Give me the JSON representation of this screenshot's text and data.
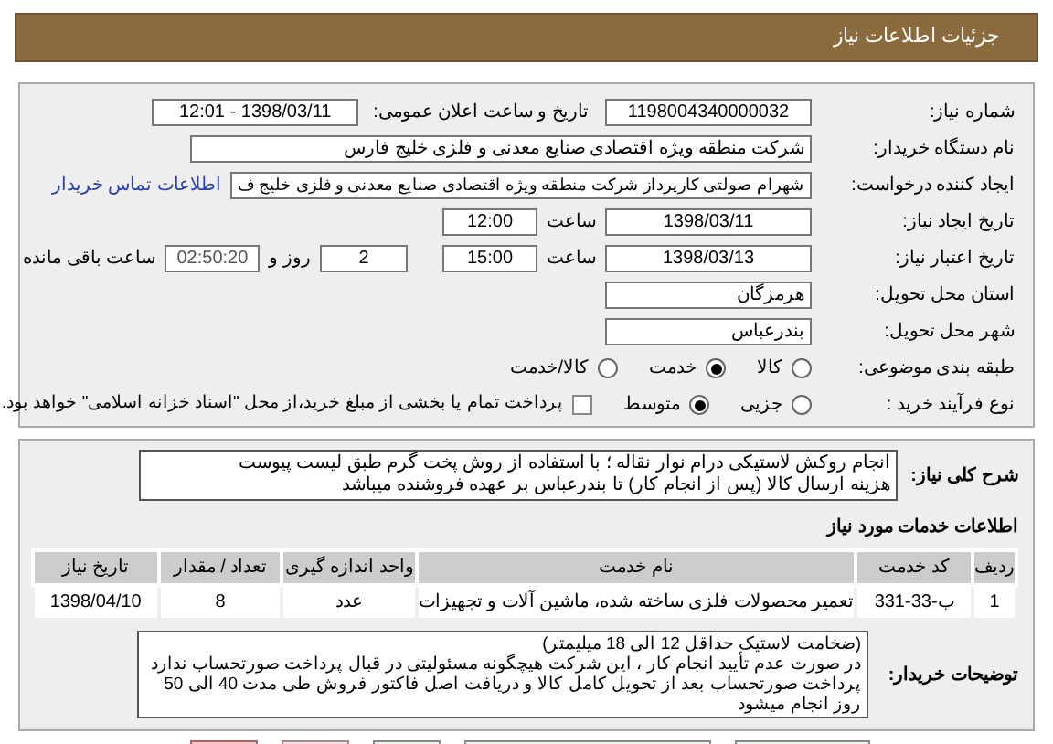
{
  "header": {
    "title": "جزئیات اطلاعات نیاز"
  },
  "form": {
    "need_number": {
      "label": "شماره نیاز:",
      "value": "1198004340000032"
    },
    "announce": {
      "label": "تاریخ و ساعت اعلان عمومی:",
      "value": "1398/03/11 - 12:01"
    },
    "buyer_org": {
      "label": "نام دستگاه خریدار:",
      "value": "شرکت منطقه ویژه اقتصادی صنایع معدنی و فلزی خلیج فارس"
    },
    "creator": {
      "label": "ایجاد کننده درخواست:",
      "value": "شهرام صولتی کارپرداز شرکت منطقه ویژه اقتصادی صنایع معدنی و فلزی خلیج ف",
      "link": "اطلاعات تماس خریدار"
    },
    "created": {
      "label": "تاریخ ایجاد نیاز:",
      "date": "1398/03/11",
      "time_label": "ساعت",
      "time": "12:00"
    },
    "valid": {
      "label": "تاریخ اعتبار نیاز:",
      "date": "1398/03/13",
      "time_label": "ساعت",
      "time": "15:00",
      "days": "2",
      "days_label": "روز و",
      "remaining": "02:50:20",
      "remaining_label": "ساعت باقی مانده"
    },
    "province": {
      "label": "استان محل تحویل:",
      "value": "هرمزگان"
    },
    "city": {
      "label": "شهر محل تحویل:",
      "value": "بندرعباس"
    },
    "category": {
      "label": "طبقه بندی موضوعی:",
      "options": [
        {
          "label": "کالا",
          "selected": false
        },
        {
          "label": "خدمت",
          "selected": true
        },
        {
          "label": "کالا/خدمت",
          "selected": false
        }
      ]
    },
    "process": {
      "label": "نوع فرآیند خرید :",
      "options": [
        {
          "label": "جزیی",
          "selected": false
        },
        {
          "label": "متوسط",
          "selected": true
        }
      ],
      "treasury": {
        "label": "پرداخت تمام یا بخشی از مبلغ خرید،از محل \"اسناد خزانه اسلامی\" خواهد بود.",
        "checked": false
      }
    }
  },
  "description": {
    "label": "شرح کلی نیاز:",
    "lines": [
      "انجام روکش لاستیکی درام نوار نقاله ؛ با استفاده از روش پخت گرم طبق لیست پیوست",
      "هزینه ارسال کالا (پس از انجام کار) تا بندرعباس بر عهده فروشنده میباشد"
    ]
  },
  "services": {
    "title": "اطلاعات خدمات مورد نیاز",
    "columns": [
      "ردیف",
      "کد خدمت",
      "نام خدمت",
      "واحد اندازه گیری",
      "تعداد / مقدار",
      "تاریخ نیاز"
    ],
    "rows": [
      [
        "1",
        "ب-33-331",
        "تعمیر محصولات فلزی ساخته شده، ماشین آلات و تجهیزات",
        "عدد",
        "8",
        "1398/04/10"
      ]
    ]
  },
  "buyer_notes": {
    "label": "توضیحات خریدار:",
    "lines": [
      "(ضخامت لاستیک حداقل 12 الی 18 میلیمتر)",
      "در صورت عدم تأیید انجام کار ، این شرکت هیچگونه مسئولیتی در قبال پرداخت صورتحساب ندارد",
      "پرداخت صورتحساب بعد از تحویل کامل کالا و دریافت اصل فاکتور فروش طی مدت 40 الی 50 روز انجام میشود"
    ]
  },
  "bottom_buttons": [
    {
      "kind": "normal"
    },
    {
      "kind": "normal"
    },
    {
      "kind": "normal"
    },
    {
      "kind": "back"
    },
    {
      "kind": "exit"
    }
  ]
}
